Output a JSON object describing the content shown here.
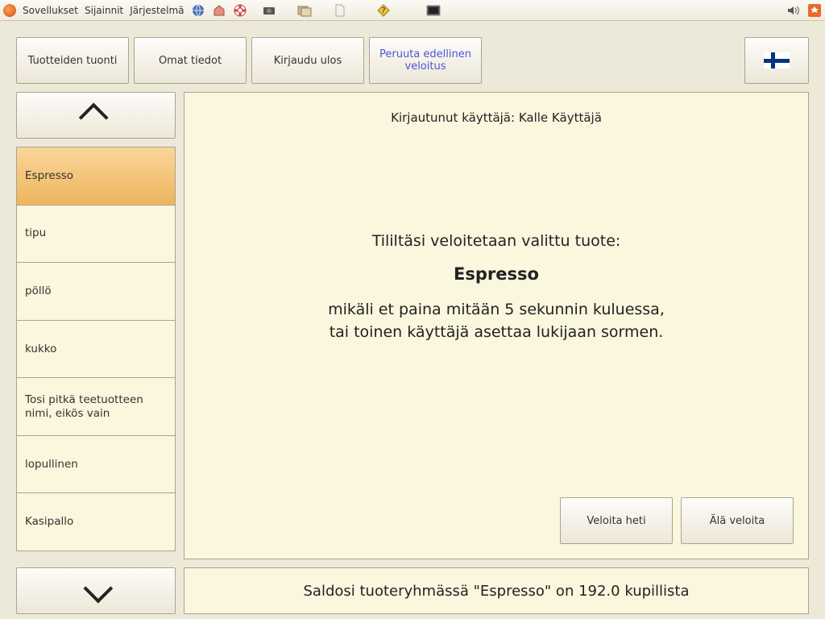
{
  "panel": {
    "menu": {
      "apps": "Sovellukset",
      "places": "Sijainnit",
      "system": "Järjestelmä"
    }
  },
  "topButtons": {
    "import": "Tuotteiden tuonti",
    "ownInfo": "Omat tiedot",
    "logout": "Kirjaudu ulos",
    "cancel": "Peruuta edellinen veloitus"
  },
  "products": [
    {
      "name": "Espresso",
      "selected": true
    },
    {
      "name": "tipu",
      "selected": false
    },
    {
      "name": "pöllö",
      "selected": false
    },
    {
      "name": "kukko",
      "selected": false
    },
    {
      "name": "Tosi pitkä teetuotteen nimi, eikös vain",
      "selected": false
    },
    {
      "name": "lopullinen",
      "selected": false
    },
    {
      "name": "Kasipallo",
      "selected": false
    }
  ],
  "main": {
    "userLabelPrefix": "Kirjautunut käyttäjä: ",
    "userName": "Kalle Käyttäjä",
    "chargeIntro": "Tililtäsi veloitetaan valittu tuote:",
    "chargeProduct": "Espresso",
    "chargeLine1": "mikäli et paina mitään 5 sekunnin kuluessa,",
    "chargeLine2": "tai toinen käyttäjä asettaa lukijaan sormen.",
    "chargeNow": "Veloita heti",
    "dontCharge": "Älä veloita"
  },
  "balance": "Saldosi tuoteryhmässä \"Espresso\" on 192.0 kupillista"
}
